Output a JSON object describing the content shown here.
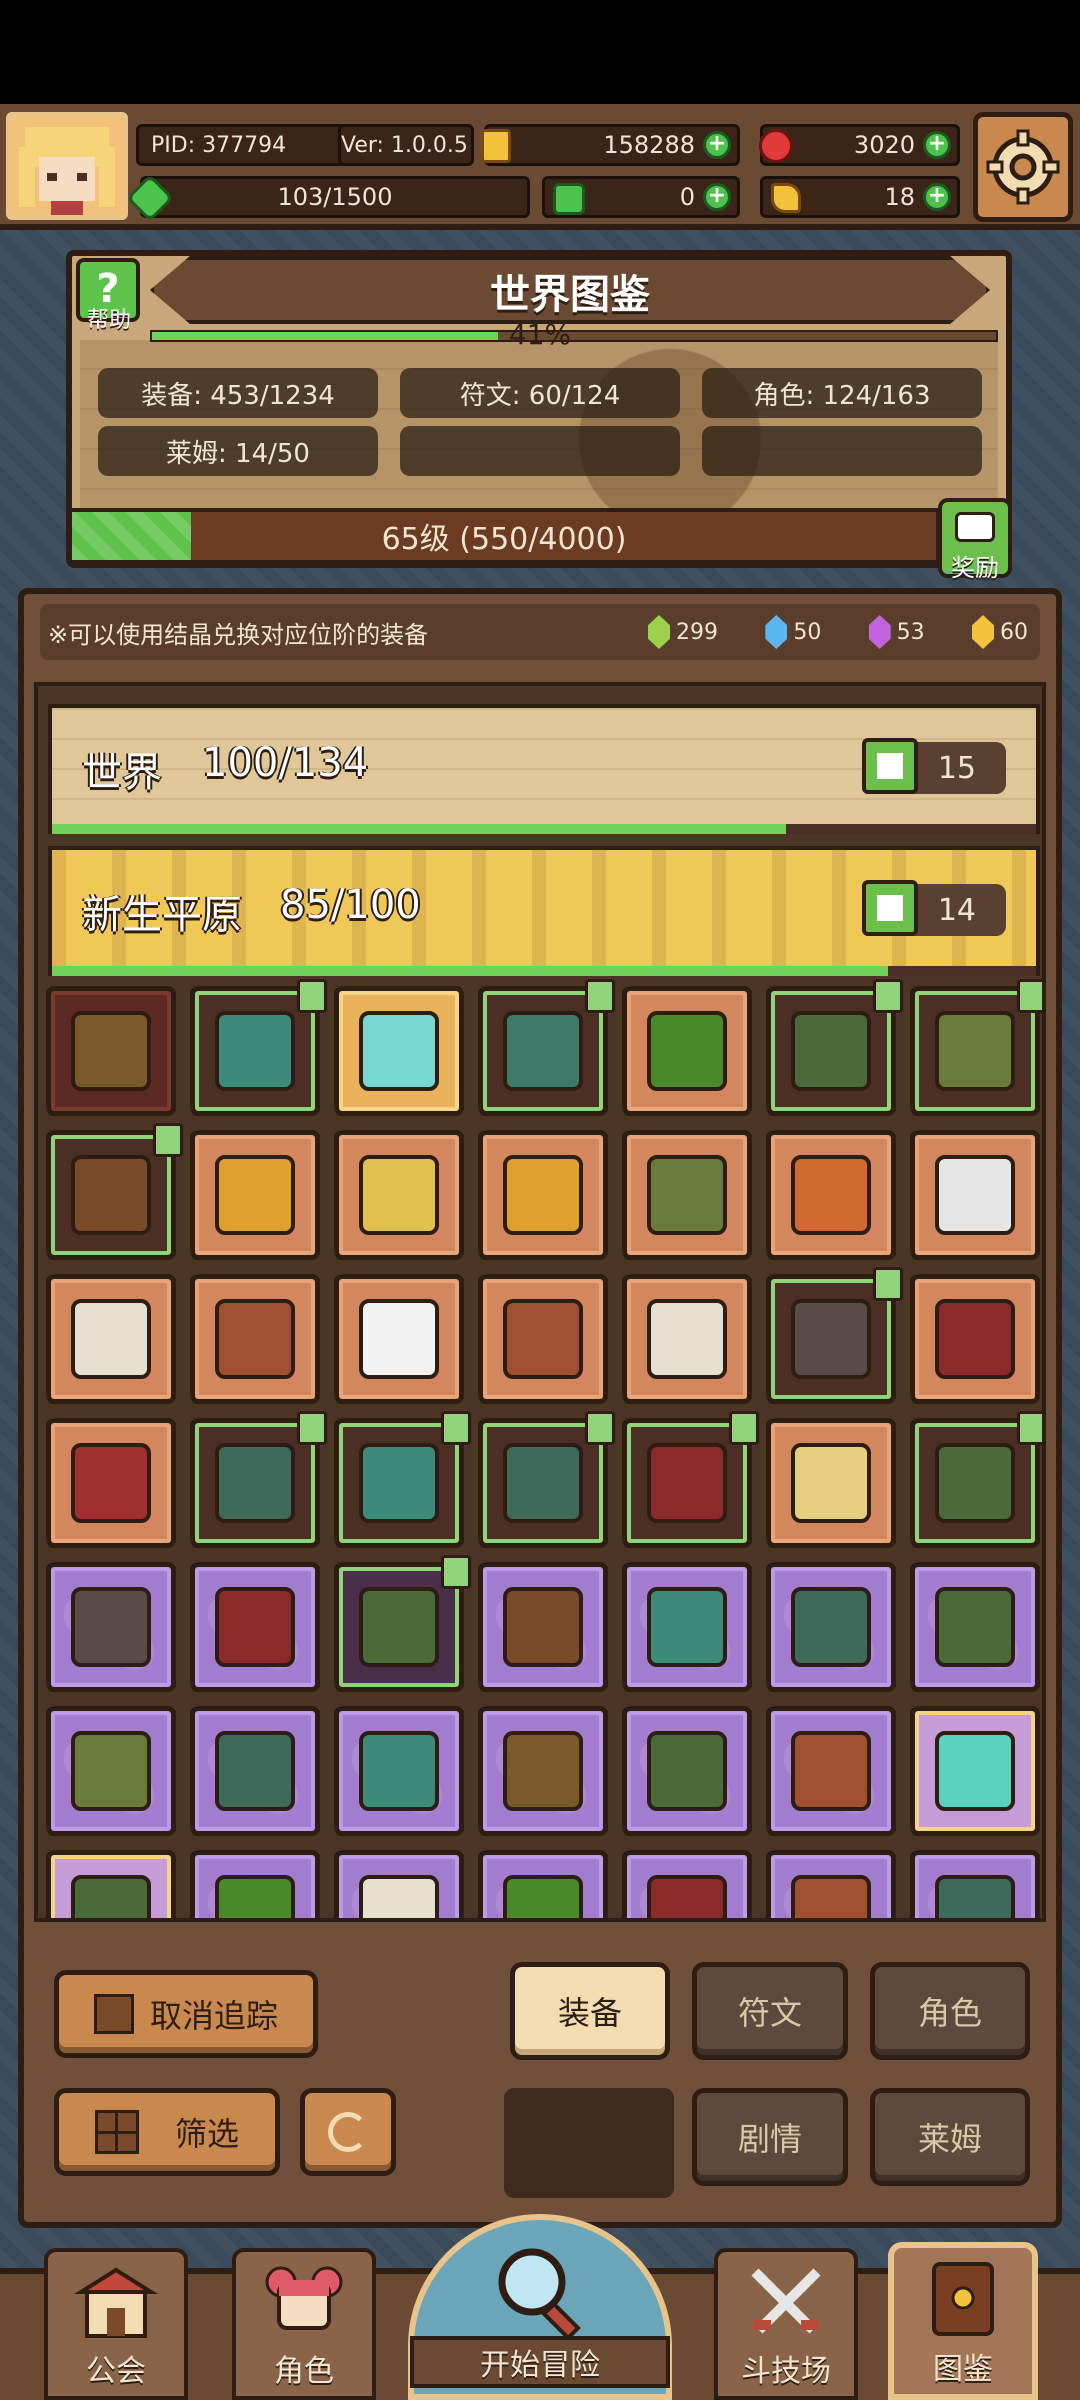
{
  "header": {
    "pid": "PID: 377794",
    "version": "Ver: 1.0.0.5",
    "gold": "158288",
    "ruby": "3020",
    "stamina": "103/1500",
    "clover": "0",
    "feather": "18"
  },
  "encyclopedia": {
    "title": "世界图鉴",
    "help_label": "帮助",
    "progress_text": "41%",
    "progress_fraction": 0.41,
    "stats": [
      "装备: 453/1234",
      "符文: 60/124",
      "角色: 124/163",
      "莱姆: 14/50"
    ],
    "level_text": "65级 (550/4000)",
    "level_fraction": 0.1375,
    "reward_label": "奖励"
  },
  "notice": {
    "text": "※可以使用结晶兑换对应位阶的装备",
    "crystals": [
      {
        "color": "#9ccf4a",
        "count": "299"
      },
      {
        "color": "#5ab7f2",
        "count": "50"
      },
      {
        "color": "#c064e0",
        "count": "53"
      },
      {
        "color": "#f2c23a",
        "count": "60"
      }
    ]
  },
  "regions": [
    {
      "name": "世界",
      "progress": "100/134",
      "likes": "15",
      "fraction": 0.746
    },
    {
      "name": "新生平原",
      "progress": "85/100",
      "likes": "14",
      "fraction": 0.85
    }
  ],
  "items": [
    [
      "maroon",
      "hat-icon",
      false
    ],
    [
      "dark",
      "mace-icon",
      true
    ],
    [
      "gold",
      "crystal-orb-icon",
      false
    ],
    [
      "dark",
      "gem-icon",
      true
    ],
    [
      "orange",
      "helmet-icon",
      false
    ],
    [
      "dark",
      "armor-icon",
      true
    ],
    [
      "dark",
      "ring-icon",
      true
    ],
    [
      "dark",
      "crossbow-icon",
      true
    ],
    [
      "orange",
      "arrow-icon",
      false
    ],
    [
      "orange",
      "amulet-icon",
      false
    ],
    [
      "orange",
      "horn-icon",
      false
    ],
    [
      "orange",
      "ring-icon",
      false
    ],
    [
      "orange",
      "gem-ring-icon",
      false
    ],
    [
      "orange",
      "axe-icon",
      false
    ],
    [
      "orange",
      "necklace-icon",
      false
    ],
    [
      "orange",
      "pouch-icon",
      false
    ],
    [
      "orange",
      "pearl-icon",
      false
    ],
    [
      "orange",
      "gauntlet-icon",
      false
    ],
    [
      "orange",
      "necklace-icon",
      false
    ],
    [
      "dark",
      "sword-icon",
      true
    ],
    [
      "orange",
      "hood-icon",
      false
    ],
    [
      "orange",
      "cape-icon",
      false
    ],
    [
      "dark",
      "bow-icon",
      true
    ],
    [
      "dark",
      "spear-icon",
      true
    ],
    [
      "dark",
      "boots-icon",
      true
    ],
    [
      "dark",
      "hood-icon",
      true
    ],
    [
      "orange",
      "scroll-icon",
      false
    ],
    [
      "dark",
      "armor-icon",
      true
    ],
    [
      "purple",
      "sword-icon",
      false
    ],
    [
      "purple",
      "hood-icon",
      false
    ],
    [
      "purpledark",
      "armor-icon",
      true
    ],
    [
      "purple",
      "crossbow-icon",
      false
    ],
    [
      "purple",
      "spear-icon",
      false
    ],
    [
      "purple",
      "boots-icon",
      false
    ],
    [
      "purple",
      "armor-icon",
      false
    ],
    [
      "purple",
      "ring-icon",
      false
    ],
    [
      "purple",
      "boots-icon",
      false
    ],
    [
      "purple",
      "staff-icon",
      false
    ],
    [
      "purple",
      "hat-icon",
      false
    ],
    [
      "purple",
      "armor-icon",
      false
    ],
    [
      "purple",
      "gauntlet-icon",
      false
    ],
    [
      "purplegold",
      "crystal-icon",
      false
    ],
    [
      "purplegold",
      "armor-icon",
      false
    ],
    [
      "purple",
      "helmet-icon",
      false
    ],
    [
      "purple",
      "necklace-icon",
      false
    ],
    [
      "purple",
      "helmet-icon",
      false
    ],
    [
      "purple",
      "hood-icon",
      false
    ],
    [
      "purple",
      "pouch-icon",
      false
    ],
    [
      "purple",
      "boots-icon",
      false
    ]
  ],
  "buttons": {
    "untrack": "取消追踪",
    "filter": "筛选",
    "equipment": "装备",
    "runes": "符文",
    "characters": "角色",
    "story": "剧情",
    "slime": "莱姆"
  },
  "nav": {
    "guild": "公会",
    "character": "角色",
    "start": "开始冒险",
    "arena": "斗技场",
    "codex": "图鉴"
  }
}
